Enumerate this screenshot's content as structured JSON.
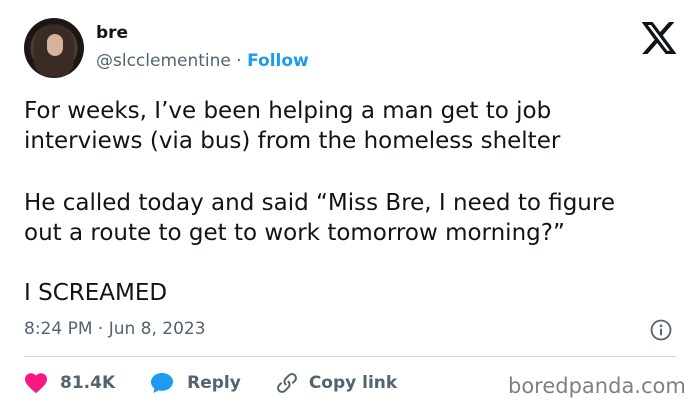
{
  "author": {
    "name": "bre",
    "handle": "@slcclementine",
    "separator": "·",
    "follow_label": "Follow"
  },
  "tweet": {
    "paragraph_1": "For weeks, I’ve been helping a man get to job\ninterviews (via bus) from the homeless shelter",
    "paragraph_2": "He called today and said “Miss Bre, I need to figure\nout a route to get to work tomorrow morning?”",
    "paragraph_3": "I SCREAMED",
    "timestamp": "8:24 PM · Jun 8, 2023"
  },
  "actions": {
    "like_count": "81.4K",
    "reply_label": "Reply",
    "copy_link_label": "Copy link"
  },
  "watermark": "boredpanda.com",
  "colors": {
    "like": "#f91880",
    "reply": "#1d9bf0",
    "link": "#1d9bf0",
    "text": "#0f1419",
    "muted": "#536471"
  },
  "icons": {
    "platform": "x-logo-icon",
    "info": "info-icon",
    "like": "heart-icon",
    "reply": "speech-bubble-icon",
    "copy_link": "link-icon"
  }
}
